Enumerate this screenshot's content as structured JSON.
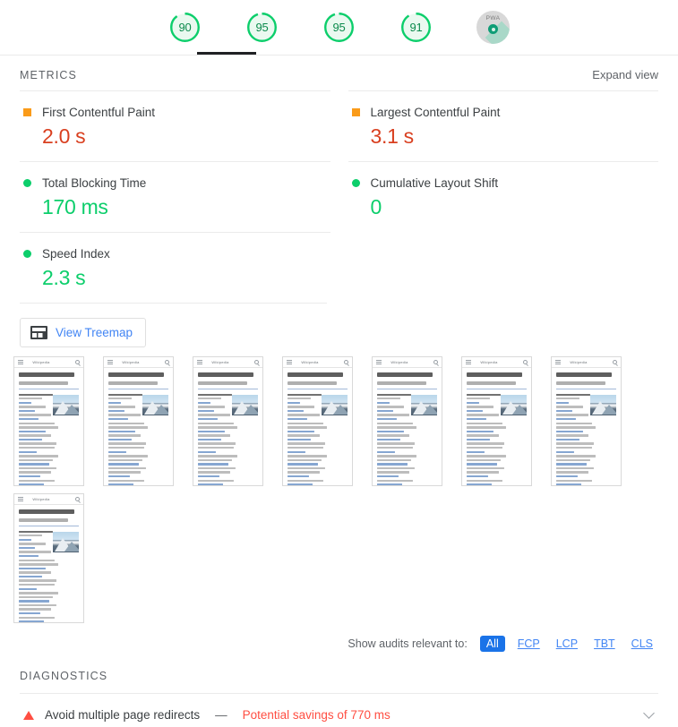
{
  "gauges": [
    {
      "name": "performance",
      "score": "90",
      "color": "#0cce6b",
      "state": "pass"
    },
    {
      "name": "accessibility",
      "score": "95",
      "color": "#0cce6b",
      "state": "pass"
    },
    {
      "name": "best-practices",
      "score": "95",
      "color": "#0cce6b",
      "state": "pass"
    },
    {
      "name": "seo",
      "score": "91",
      "color": "#0cce6b",
      "state": "pass"
    },
    {
      "name": "pwa",
      "score": "PWA",
      "color": "#a9d8c8",
      "state": "badge"
    }
  ],
  "metrics_section": {
    "title": "METRICS",
    "expand_label": "Expand view",
    "items": [
      {
        "label": "First Contentful Paint",
        "value": "2.0 s",
        "indicator": "square",
        "rating": "average"
      },
      {
        "label": "Largest Contentful Paint",
        "value": "3.1 s",
        "indicator": "square",
        "rating": "average"
      },
      {
        "label": "Total Blocking Time",
        "value": "170 ms",
        "indicator": "circle",
        "rating": "pass"
      },
      {
        "label": "Cumulative Layout Shift",
        "value": "0",
        "indicator": "circle",
        "rating": "pass"
      },
      {
        "label": "Speed Index",
        "value": "2.3 s",
        "indicator": "circle",
        "rating": "pass"
      }
    ]
  },
  "treemap": {
    "label": "View Treemap",
    "icon": "treemap-icon"
  },
  "filmstrip": {
    "count": 8,
    "thumbnail": {
      "brand": "Wikipedia",
      "heading": "Bienvenue sur Wikipédia",
      "subheading": "Aperçu concis et concis"
    }
  },
  "audit_filter": {
    "label": "Show audits relevant to:",
    "options": [
      {
        "label": "All",
        "active": true
      },
      {
        "label": "FCP",
        "active": false
      },
      {
        "label": "LCP",
        "active": false
      },
      {
        "label": "TBT",
        "active": false
      },
      {
        "label": "CLS",
        "active": false
      }
    ]
  },
  "diagnostics": {
    "title": "DIAGNOSTICS",
    "items": [
      {
        "title": "Avoid multiple page redirects",
        "dash": "—",
        "savings": "Potential savings of 770 ms",
        "indicator": "triangle"
      }
    ]
  },
  "colors": {
    "pass": "#0cce6b",
    "average": "#fa9b19",
    "average_text": "#d93f1f",
    "fail": "#ff4e42",
    "link": "#4285f4",
    "chip_active": "#1a73e8",
    "text": "#3c4043",
    "muted": "#5f6368"
  }
}
